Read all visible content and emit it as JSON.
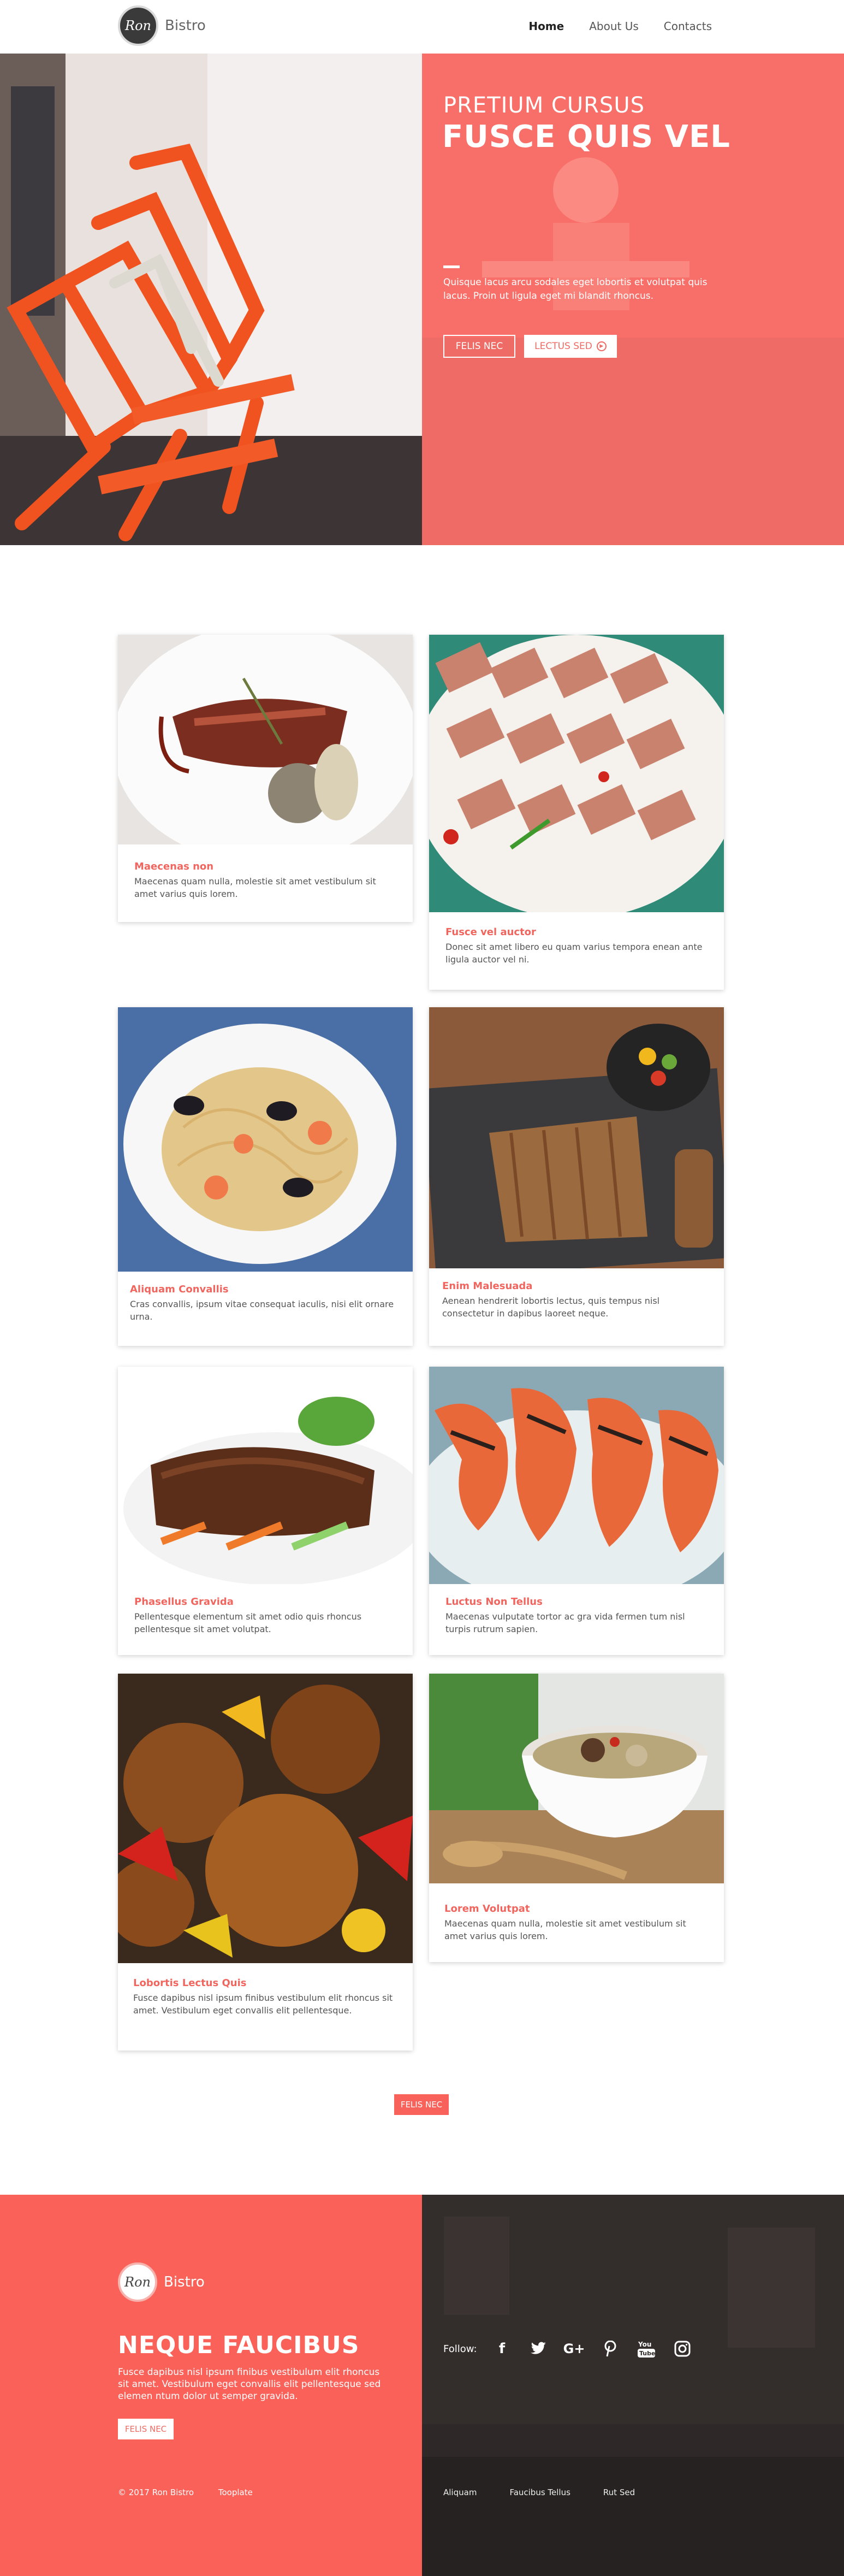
{
  "brand": {
    "monogram": "Ron",
    "name": "Bistro"
  },
  "nav": {
    "items": [
      "Home",
      "About Us",
      "Contacts"
    ],
    "active": "Home"
  },
  "hero": {
    "eyebrow": "PRETIUM CURSUS",
    "title": "FUSCE QUIS VEL",
    "text": "Quisque lacus arcu sodales eget lobortis et volutpat quis lacus. Proin ut ligula eget mi blandit rhoncus.",
    "button_primary": "FELIS NEC",
    "button_secondary": "LECTUS SED"
  },
  "cards": [
    {
      "title": "Maecenas non",
      "text": "Maecenas quam nulla, molestie sit amet vestibulum sit amet varius quis lorem.",
      "image": "steak-plate"
    },
    {
      "title": "Fusce vel auctor",
      "text": "Donec sit amet libero eu quam varius tempora enean ante ligula auctor vel ni.",
      "image": "pork-belly"
    },
    {
      "title": "Aliquam Convallis",
      "text": "Cras convallis, ipsum vitae consequat iaculis, nisi elit ornare urna.",
      "image": "seafood-pasta"
    },
    {
      "title": "Enim Malesuada",
      "text": "Aenean hendrerit lobortis lectus, quis tempus nisl consectetur in dapibus laoreet neque.",
      "image": "grilled-ribs"
    },
    {
      "title": "Phasellus Gravida",
      "text": "Pellentesque elementum sit amet odio quis rhoncus pellentesque sit amet volutpat.",
      "image": "rolled-beef"
    },
    {
      "title": "Luctus Non Tellus",
      "text": "Maecenas vulputate tortor ac gra vida fermen tum nisl turpis rutrum sapien.",
      "image": "grilled-prawns"
    },
    {
      "title": "Lobortis Lectus Quis",
      "text": "Fusce dapibus nisl ipsum finibus vestibulum elit rhoncus sit amet. Vestibulum eget convallis elit pellentesque.",
      "image": "meatballs"
    },
    {
      "title": "Lorem Volutpat",
      "text": "Maecenas quam nulla, molestie sit amet vestibulum sit amet varius quis lorem.",
      "image": "soup-bowl"
    }
  ],
  "more_button": "FELIS NEC",
  "footer": {
    "title": "NEQUE FAUCIBUS",
    "text": "Fusce dapibus nisl ipsum finibus vestibulum elit rhoncus sit amet.  Vestibulum eget convallis elit pellentesque sed elemen ntum dolor ut semper gravida.",
    "button": "FELIS NEC",
    "copyright": "© 2017  Ron Bistro",
    "credit": "Tooplate",
    "follow_label": "Follow:",
    "social": [
      "facebook-icon",
      "twitter-icon",
      "google-plus-icon",
      "pinterest-icon",
      "youtube-icon",
      "instagram-icon"
    ],
    "links": [
      "Aliquam",
      "Faucibus Tellus",
      "Rut Sed"
    ]
  }
}
